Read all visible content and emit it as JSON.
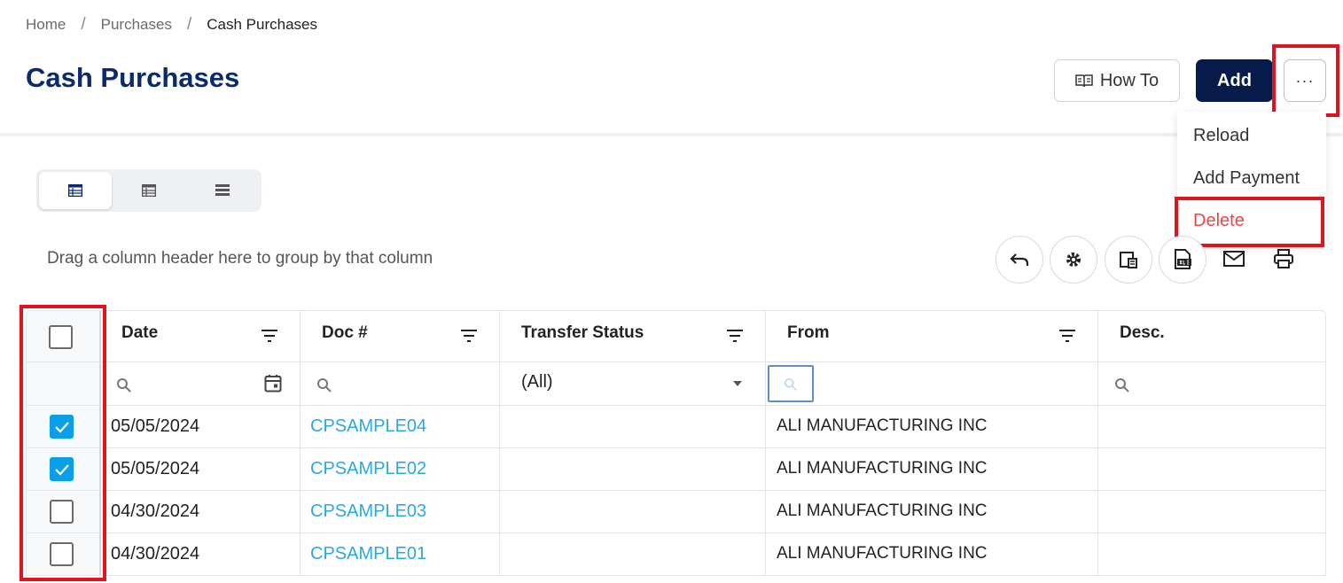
{
  "breadcrumb": {
    "home": "Home",
    "purchases": "Purchases",
    "current": "Cash Purchases",
    "separator": "/"
  },
  "page": {
    "title": "Cash Purchases"
  },
  "toolbar": {
    "howto_label": "How To",
    "add_label": "Add",
    "more_label": "···"
  },
  "menu": {
    "reload": "Reload",
    "add_payment": "Add Payment",
    "delete": "Delete"
  },
  "grid": {
    "group_hint": "Drag a column header here to group by that column",
    "columns": [
      "Date",
      "Doc #",
      "Transfer Status",
      "From",
      "Desc."
    ],
    "status_filter": "(All)",
    "rows": [
      {
        "checked": true,
        "date": "05/05/2024",
        "doc": "CPSAMPLE04",
        "status": "",
        "from": "ALI MANUFACTURING INC",
        "desc": ""
      },
      {
        "checked": true,
        "date": "05/05/2024",
        "doc": "CPSAMPLE02",
        "status": "",
        "from": "ALI MANUFACTURING INC",
        "desc": ""
      },
      {
        "checked": false,
        "date": "04/30/2024",
        "doc": "CPSAMPLE03",
        "status": "",
        "from": "ALI MANUFACTURING INC",
        "desc": ""
      },
      {
        "checked": false,
        "date": "04/30/2024",
        "doc": "CPSAMPLE01",
        "status": "",
        "from": "ALI MANUFACTURING INC",
        "desc": ""
      }
    ]
  },
  "colors": {
    "title": "#0b2a6b",
    "primary_button": "#071b4a",
    "link": "#2aa8e6",
    "checkbox_checked": "#0a9fe6",
    "danger": "#e5484d",
    "highlight_box": "#e0141e"
  }
}
